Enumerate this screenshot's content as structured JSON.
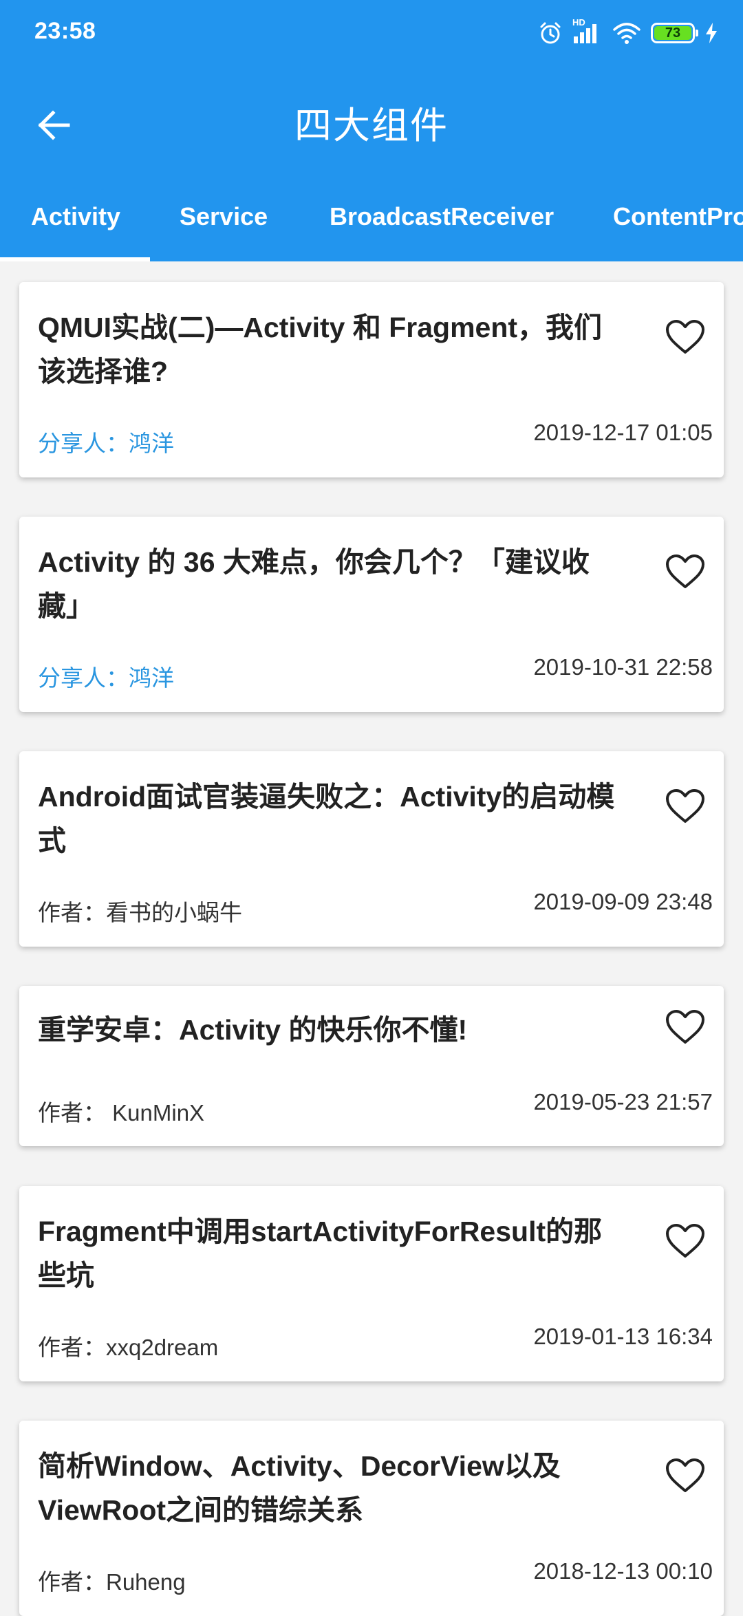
{
  "status": {
    "time": "23:58",
    "battery": "73",
    "hd": "HD"
  },
  "app_bar": {
    "title": "四大组件"
  },
  "tabs": [
    "Activity",
    "Service",
    "BroadcastReceiver",
    "ContentProvider"
  ],
  "colors": {
    "primary": "#2295ee",
    "sharer": "#2a96e0",
    "battery": "#67e021"
  },
  "articles": [
    {
      "title": "QMUI实战(二)—Activity 和 Fragment，我们该选择谁?",
      "author": "分享人：鸿洋",
      "date": "2019-12-17 01:05",
      "author_type": "sharer"
    },
    {
      "title": "Activity 的 36 大难点，你会几个？「建议收藏」",
      "author": "分享人：鸿洋",
      "date": "2019-10-31 22:58",
      "author_type": "sharer"
    },
    {
      "title": "Android面试官装逼失败之：Activity的启动模式",
      "author": "作者：看书的小蜗牛",
      "date": "2019-09-09 23:48",
      "author_type": "author"
    },
    {
      "title": "重学安卓：Activity 的快乐你不懂!",
      "author": "作者： KunMinX",
      "date": "2019-05-23 21:57",
      "author_type": "author"
    },
    {
      "title": "Fragment中调用startActivityForResult的那些坑",
      "author": "作者：xxq2dream",
      "date": "2019-01-13 16:34",
      "author_type": "author"
    },
    {
      "title": "简析Window、Activity、DecorView以及ViewRoot之间的错综关系",
      "author": "作者：Ruheng",
      "date": "2018-12-13 00:10",
      "author_type": "author"
    }
  ],
  "icons": {
    "back": "arrow-back-icon",
    "favorite": "heart-outline-icon"
  }
}
